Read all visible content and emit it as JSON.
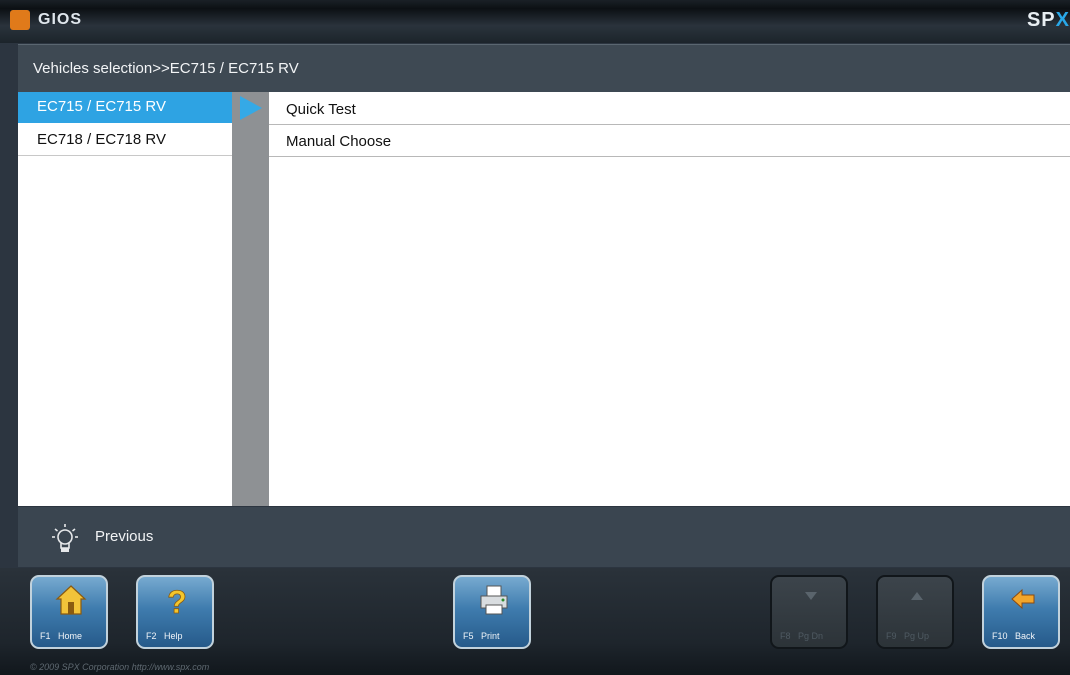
{
  "app": {
    "title": "GIOS",
    "brand_left": "SP",
    "brand_right": "X"
  },
  "breadcrumb": "Vehicles selection>>EC715 / EC715 RV",
  "vehicles": [
    {
      "label": "EC715 / EC715 RV",
      "selected": true
    },
    {
      "label": "EC718 / EC718 RV",
      "selected": false
    }
  ],
  "options": [
    {
      "label": "Quick Test"
    },
    {
      "label": "Manual Choose"
    }
  ],
  "hint": {
    "icon": "lightbulb-icon",
    "text": "Previous"
  },
  "function_keys": [
    {
      "key": "F1",
      "label": "Home",
      "icon": "home-icon",
      "enabled": true
    },
    {
      "key": "F2",
      "label": "Help",
      "icon": "question-icon",
      "enabled": true
    },
    {
      "key": "F5",
      "label": "Print",
      "icon": "printer-icon",
      "enabled": true
    },
    {
      "key": "F8",
      "label": "Pg Dn",
      "icon": "arrow-down-icon",
      "enabled": false
    },
    {
      "key": "F9",
      "label": "Pg Up",
      "icon": "arrow-up-icon",
      "enabled": false
    },
    {
      "key": "F10",
      "label": "Back",
      "icon": "back-arrow-icon",
      "enabled": true
    }
  ],
  "footer": {
    "copyright": "© 2009 SPX Corporation   http://www.spx.com"
  },
  "colors": {
    "accent": "#2ea3e3",
    "background": "#2c3540",
    "button": "#3f7cae"
  }
}
